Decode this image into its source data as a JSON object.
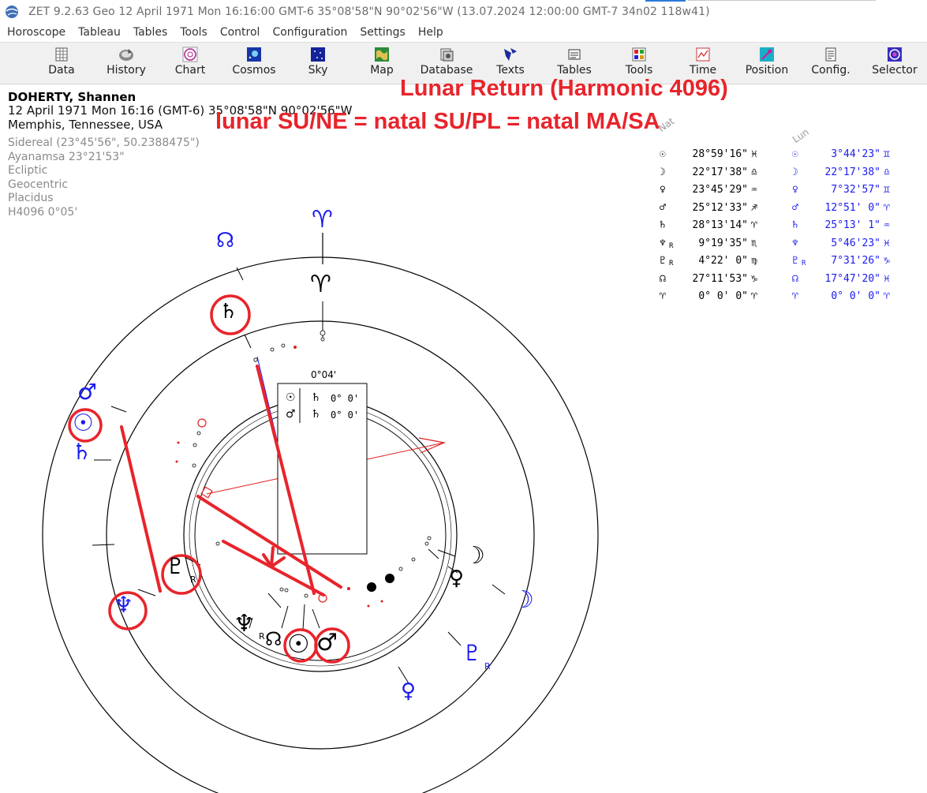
{
  "window": {
    "title": "ZET 9.2.63 Geo   12 April 1971  Mon  16:16:00 GMT-6 35°08'58\"N  90°02'56\"W  (13.07.2024  12:00:00 GMT-7 34n02 118w41)"
  },
  "menu": [
    "Horoscope",
    "Tableau",
    "Tables",
    "Tools",
    "Control",
    "Configuration",
    "Settings",
    "Help"
  ],
  "toolbar": [
    {
      "label": "Data",
      "icon": "data-icon"
    },
    {
      "label": "History",
      "icon": "history-icon"
    },
    {
      "label": "Chart",
      "icon": "chart-icon"
    },
    {
      "label": "Cosmos",
      "icon": "cosmos-icon"
    },
    {
      "label": "Sky",
      "icon": "sky-icon"
    },
    {
      "label": "Map",
      "icon": "map-icon"
    },
    {
      "label": "Database",
      "icon": "database-icon"
    },
    {
      "label": "Texts",
      "icon": "texts-icon"
    },
    {
      "label": "Tables",
      "icon": "tables-icon"
    },
    {
      "label": "Tools",
      "icon": "tools-icon"
    },
    {
      "label": "Time",
      "icon": "time-icon"
    },
    {
      "label": "Position",
      "icon": "position-icon"
    },
    {
      "label": "Config.",
      "icon": "config-icon"
    },
    {
      "label": "Selector",
      "icon": "selector-icon"
    }
  ],
  "person": {
    "name": "DOHERTY, Shannen",
    "datetime": "12 April 1971  Mon  16:16 (GMT-6) 35°08'58\"N  90°02'56\"W",
    "place": "Memphis, Tennessee, USA"
  },
  "settings": [
    "Sidereal (23°45'56\", 50.2388475\")",
    "Ayanamsa 23°21'53\"",
    "Ecliptic",
    "Geocentric",
    "Placidus",
    "H4096    0°05'"
  ],
  "annotation": {
    "title": "Lunar Return (Harmonic 4096)",
    "subtitle": "lunar SU/NE = natal SU/PL = natal MA/SA"
  },
  "table": {
    "headers": {
      "natal": "Nat",
      "lunar": "Lun"
    },
    "rows": [
      {
        "glyph": "☉",
        "natal": "28°59'16\"",
        "natal_sign": "♓",
        "lunar": "3°44'23\"",
        "lunar_sign": "♊"
      },
      {
        "glyph": "☽",
        "natal": "22°17'38\"",
        "natal_sign": "♎",
        "lunar": "22°17'38\"",
        "lunar_sign": "♎"
      },
      {
        "glyph": "♀",
        "natal": "23°45'29\"",
        "natal_sign": "♒",
        "lunar": "7°32'57\"",
        "lunar_sign": "♊"
      },
      {
        "glyph": "♂",
        "natal": "25°12'33\"",
        "natal_sign": "♐",
        "lunar": "12°51' 0\"",
        "lunar_sign": "♈"
      },
      {
        "glyph": "♄",
        "natal": "28°13'14\"",
        "natal_sign": "♈",
        "lunar": "25°13' 1\"",
        "lunar_sign": "♒"
      },
      {
        "glyph": "♆",
        "natal_retro": "R",
        "lunar_glyph": "♆",
        "natal": "9°19'35\"",
        "natal_sign": "♏",
        "lunar": "5°46'23\"",
        "lunar_sign": "♓"
      },
      {
        "glyph": "♇",
        "natal_retro": "R",
        "lunar_glyph": "♇",
        "lunar_retro": "R",
        "natal": "4°22' 0\"",
        "natal_sign": "♍",
        "lunar": "7°31'26\"",
        "lunar_sign": "♑"
      },
      {
        "glyph": "☊",
        "natal": "27°11'53\"",
        "natal_sign": "♑",
        "lunar": "17°47'20\"",
        "lunar_sign": "♓"
      },
      {
        "glyph": "♈",
        "natal": "0° 0' 0\"",
        "natal_sign": "♈",
        "lunar": "0° 0' 0\"",
        "lunar_sign": "♈"
      }
    ]
  },
  "wheel": {
    "inset_title": "0°04'",
    "inset_rows": [
      {
        "a": "☉",
        "b": "♄",
        "val": "0° 0'"
      },
      {
        "a": "♂",
        "b": "♄",
        "val": "0° 0'"
      }
    ],
    "retro_mark": "R",
    "outer_glyphs": [
      "♈",
      "☊",
      "♂",
      "☉",
      "♄",
      "♆",
      "♀",
      "♇",
      "☽"
    ],
    "inner_glyphs": [
      "♈",
      "♄",
      "♇",
      "♆",
      "☊",
      "☉",
      "♂",
      "♀",
      "☽"
    ]
  },
  "colors": {
    "annotation": "#e8242b",
    "lunar": "#1a1aef",
    "natal": "#000000"
  }
}
